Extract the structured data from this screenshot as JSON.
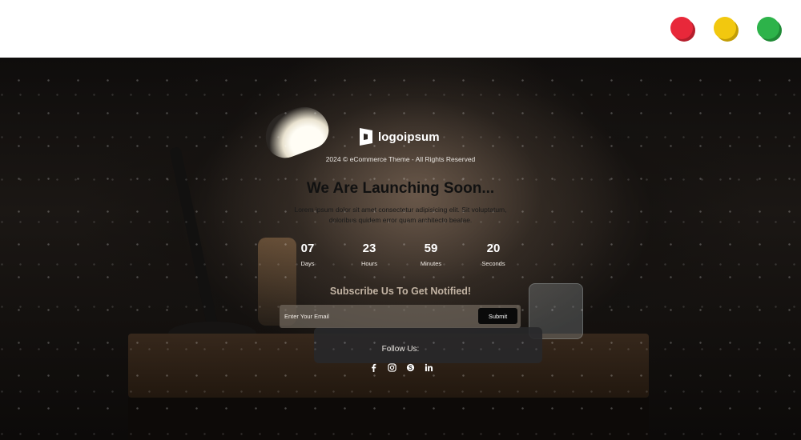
{
  "window": {
    "controls": [
      "close",
      "minimize",
      "maximize"
    ],
    "colors": {
      "close": "#e8283a",
      "minimize": "#f2c80f",
      "maximize": "#2db34a"
    }
  },
  "brand": {
    "name": "logoipsum",
    "logo_icon": "logo-mark-icon"
  },
  "copyright": "2024 © eCommerce Theme - All Rights Reserved",
  "headline": "We Are Launching Soon...",
  "description": "Lorem ipsum dolor sit amet consectetur adipisicing elit. Sit voluptatum, doloribus quidem error quam architecto beatae.",
  "countdown": [
    {
      "value": "07",
      "label": "Days"
    },
    {
      "value": "23",
      "label": "Hours"
    },
    {
      "value": "59",
      "label": "Minutes"
    },
    {
      "value": "20",
      "label": "Seconds"
    }
  ],
  "subscribe": {
    "title": "Subscribe Us To Get Notified!",
    "placeholder": "Enter Your Email",
    "value": "",
    "button_label": "Submit"
  },
  "follow": {
    "label": "Follow Us:",
    "socials": [
      "facebook-icon",
      "instagram-icon",
      "skype-icon",
      "linkedin-icon"
    ]
  }
}
